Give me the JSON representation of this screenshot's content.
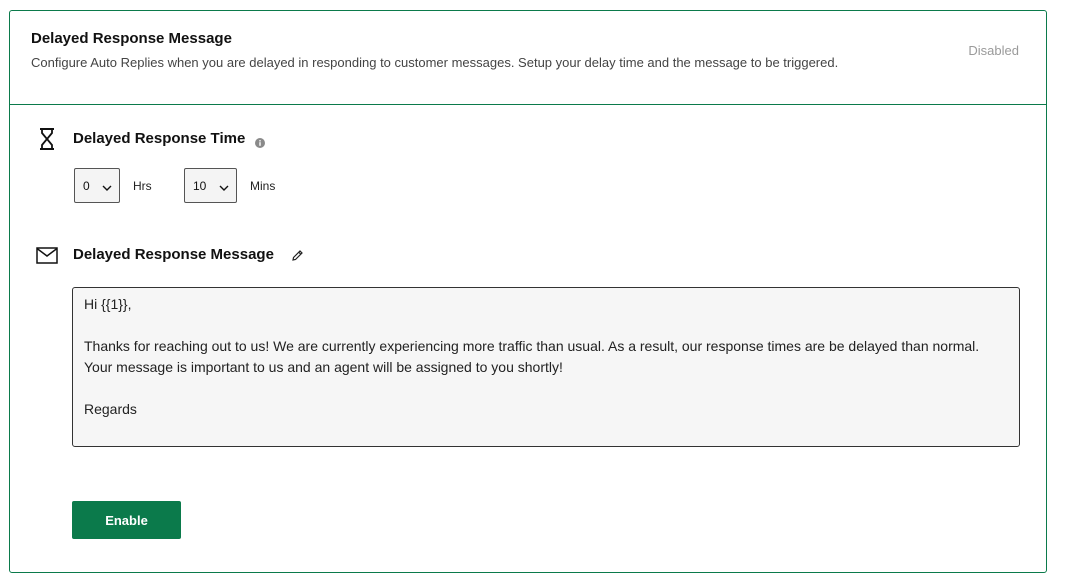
{
  "header": {
    "title": "Delayed Response Message",
    "description": "Configure Auto Replies when you are delayed in responding to customer messages. Setup your delay time and the message to be triggered.",
    "status": "Disabled"
  },
  "time_section": {
    "title": "Delayed Response Time",
    "icon": "hourglass-icon",
    "hours_value": "0",
    "hours_unit": "Hrs",
    "minutes_value": "10",
    "minutes_unit": "Mins"
  },
  "message_section": {
    "title": "Delayed Response Message",
    "icon": "envelope-icon",
    "lines": [
      "Hi {{1}},",
      "",
      "Thanks for reaching out to us! We are currently experiencing more traffic than usual. As a result, our response times are be delayed than normal.",
      "Your message is important to us and an agent will be assigned to you shortly!",
      "",
      "Regards"
    ]
  },
  "actions": {
    "enable_label": "Enable"
  },
  "colors": {
    "accent": "#0b7a4b",
    "status": "#9a9a9a"
  }
}
